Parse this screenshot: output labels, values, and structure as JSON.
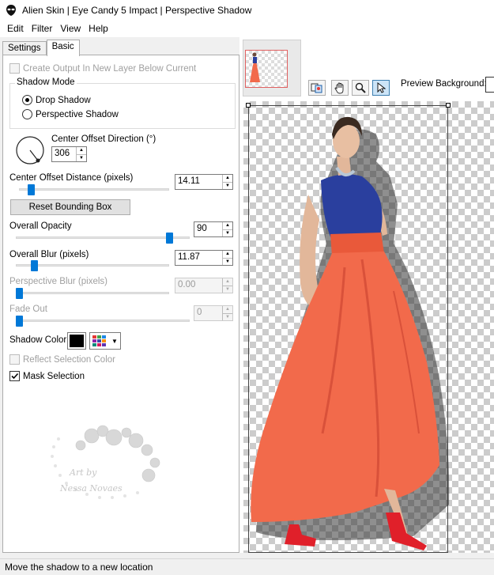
{
  "window": {
    "title": "Alien Skin | Eye Candy 5 Impact | Perspective Shadow"
  },
  "menu": [
    "Edit",
    "Filter",
    "View",
    "Help"
  ],
  "tabs": [
    "Settings",
    "Basic"
  ],
  "active_tab": "Basic",
  "basic": {
    "create_output_label": "Create Output In New Layer Below Current",
    "shadow_mode_label": "Shadow Mode",
    "drop_shadow_label": "Drop Shadow",
    "perspective_shadow_label": "Perspective Shadow",
    "selected_mode": "Drop Shadow",
    "center_offset_direction_label": "Center Offset Direction (°)",
    "center_offset_direction_value": "306",
    "center_offset_distance_label": "Center Offset Distance (pixels)",
    "center_offset_distance_value": "14.11",
    "center_offset_distance_fraction": 0.06,
    "reset_bounding_box_label": "Reset Bounding Box",
    "overall_opacity_label": "Overall Opacity",
    "overall_opacity_value": "90",
    "overall_opacity_fraction": 0.9,
    "overall_blur_label": "Overall Blur (pixels)",
    "overall_blur_value": "11.87",
    "overall_blur_fraction": 0.1,
    "perspective_blur_label": "Perspective Blur (pixels)",
    "perspective_blur_value": "0.00",
    "perspective_blur_fraction": 0.0,
    "fade_out_label": "Fade Out",
    "fade_out_value": "0",
    "fade_out_fraction": 0.0,
    "shadow_color_label": "Shadow Color",
    "shadow_color": "#000000",
    "reflect_selection_color_label": "Reflect Selection Color",
    "mask_selection_label": "Mask Selection",
    "mask_selection_checked": true
  },
  "watermark": {
    "line1": "Art by",
    "line2": "Nessa Novaes"
  },
  "preview": {
    "background_label": "Preview Background:"
  },
  "status": {
    "text": "Move the shadow to a new location"
  },
  "colors": {
    "accent": "#0078d7",
    "dress": "#f26a4b",
    "top": "#2a3f9e"
  }
}
